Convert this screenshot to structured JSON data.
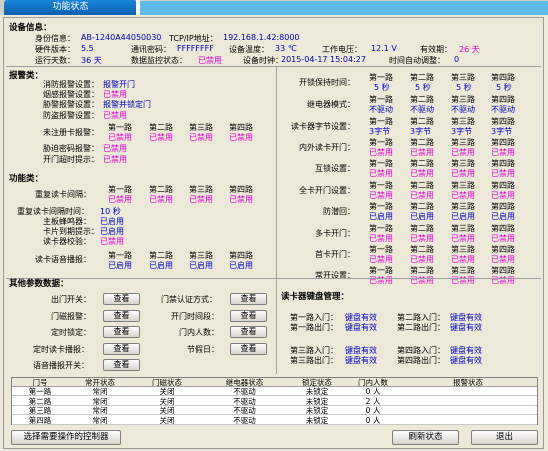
{
  "window": {
    "tab_title": "功能状态"
  },
  "device_info": {
    "heading": "设备信息：",
    "id_label": "身份信息：",
    "id_value": "AB-1240A44050030",
    "ip_label": "TCP/IP地址：",
    "ip_value": "192.168.1.42:8000",
    "hw_label": "硬件版本：",
    "hw_value": "5.5",
    "pwd_label": "通讯密码：",
    "pwd_value": "FFFFFFFF",
    "temp_label": "设备温度：",
    "temp_value": "33 ℃",
    "volt_label": "工作电压：",
    "volt_value": "12.1 V",
    "valid_label": "有效期：",
    "valid_value": "26 天",
    "run_label": "运行天数：",
    "run_value": "36 天",
    "monitor_label": "数据监控状态：",
    "monitor_value": "已禁用",
    "clock_label": "设备时钟：",
    "clock_value": "2015-04-17 15:04:27",
    "auto_label": "时间自动调整：",
    "auto_value": "0"
  },
  "alarm": {
    "heading": "报警类：",
    "fire_label": "消防报警设置：",
    "fire_value": "报警开门",
    "smoke_label": "烟感报警设置：",
    "smoke_value": "已禁用",
    "coerce_label": "胁警报警设置：",
    "coerce_value": "报警并锁定门",
    "tamper_label": "防盗报警设置：",
    "tamper_value": "已禁用",
    "unreg_label": "未注册卡报警：",
    "road_headers": [
      "第一路",
      "第二路",
      "第三路",
      "第四路"
    ],
    "unreg_values": [
      "已禁用",
      "已禁用",
      "已禁用",
      "已禁用"
    ],
    "dpwd_label": "胁迫密码报警：",
    "dpwd_value": "已禁用",
    "overtime_label": "开门超时提示：",
    "overtime_value": "已禁用"
  },
  "func": {
    "heading": "功能类：",
    "repeat_label": "重复读卡间隔：",
    "repeat_values": [
      "已禁用",
      "已禁用",
      "已禁用",
      "已禁用"
    ],
    "repeat_time_label": "重复读卡间隔时间：",
    "repeat_time_value": "10 秒",
    "buzzer_label": "主板蜂鸣器：",
    "buzzer_value": "已启用",
    "expire_label": "卡片到期提示：",
    "expire_value": "已启用",
    "verify_label": "读卡器校验：",
    "verify_value": "已禁用",
    "voice_label": "读卡语音播报：",
    "voice_values": [
      "已启用",
      "已启用",
      "已启用",
      "已启用"
    ]
  },
  "right": {
    "road_headers": [
      "第一路",
      "第二路",
      "第三路",
      "第四路"
    ],
    "keep_label": "开锁保持时间：",
    "keep_values": [
      "5 秒",
      "5 秒",
      "5 秒",
      "5 秒"
    ],
    "relay_label": "继电器模式：",
    "relay_values": [
      "不驱动",
      "不驱动",
      "不驱动",
      "不驱动"
    ],
    "bytes_label": "读卡器字节设置：",
    "bytes_values": [
      "3字节",
      "3字节",
      "3字节",
      "3字节"
    ],
    "inout_label": "内外读卡开门：",
    "inout_values": [
      "已禁用",
      "已禁用",
      "已禁用",
      "已禁用"
    ],
    "interlock_label": "互锁设置：",
    "interlock_values": [
      "已禁用",
      "已禁用",
      "已禁用",
      "已禁用"
    ],
    "allcard_label": "全卡开门设置：",
    "allcard_values": [
      "已禁用",
      "已禁用",
      "已禁用",
      "已禁用"
    ],
    "antipass_label": "防潜回：",
    "antipass_values": [
      "已启用",
      "已启用",
      "已启用",
      "已启用"
    ],
    "multi_label": "多卡开门：",
    "multi_values": [
      "已禁用",
      "已禁用",
      "已禁用",
      "已禁用"
    ],
    "first_label": "首卡开门：",
    "first_values": [
      "已禁用",
      "已禁用",
      "已禁用",
      "已禁用"
    ],
    "normal_label": "常开设置：",
    "normal_values": [
      "已禁用",
      "已禁用",
      "已禁用",
      "已禁用"
    ]
  },
  "other": {
    "heading": "其他参数数据：",
    "exit_label": "出门开关：",
    "door_magnet_label": "门磁报警：",
    "timed_lock_label": "定时锁定：",
    "timed_card_label": "定时读卡播报：",
    "voice_broadcast_label": "语音播报开关：",
    "auth_label": "门禁认证方式：",
    "open_time_label": "开门时间段：",
    "people_label": "门内人数：",
    "holiday_label": "节假日：",
    "view_label": "查看"
  },
  "keyboard": {
    "heading": "读卡器键盘管理：",
    "r1_in": "第一路入门：",
    "r1_in_v": "键盘有效",
    "r2_in": "第二路入门：",
    "r2_in_v": "键盘有效",
    "r1_out": "第一路出门：",
    "r1_out_v": "键盘有效",
    "r2_out": "第二路出门：",
    "r2_out_v": "键盘有效",
    "r3_in": "第三路入门：",
    "r3_in_v": "键盘有效",
    "r4_in": "第四路入门：",
    "r4_in_v": "键盘有效",
    "r3_out": "第三路出门：",
    "r3_out_v": "键盘有效",
    "r4_out": "第四路出门：",
    "r4_out_v": "键盘有效"
  },
  "table": {
    "headers": [
      "门号",
      "常开状态",
      "门磁状态",
      "继电器状态",
      "锁定状态",
      "门内人数",
      "报警状态"
    ],
    "rows": [
      [
        "第一路",
        "常闭",
        "关闭",
        "不驱动",
        "未锁定",
        "0 人",
        ""
      ],
      [
        "第二路",
        "常闭",
        "关闭",
        "不驱动",
        "未锁定",
        "2 人",
        ""
      ],
      [
        "第三路",
        "常闭",
        "关闭",
        "不驱动",
        "未锁定",
        "0 人",
        ""
      ],
      [
        "第四路",
        "常闭",
        "关闭",
        "不驱动",
        "未锁定",
        "0 人",
        ""
      ]
    ]
  },
  "footer": {
    "select_label": "选择需要操作的控制器",
    "refresh_label": "刷新状态",
    "exit_label": "退出"
  },
  "colors": {
    "value_blue": "#0000c8",
    "value_pink": "#e000d0",
    "tab_blue": "#0a5fb0",
    "sky": "#5bbde8"
  }
}
